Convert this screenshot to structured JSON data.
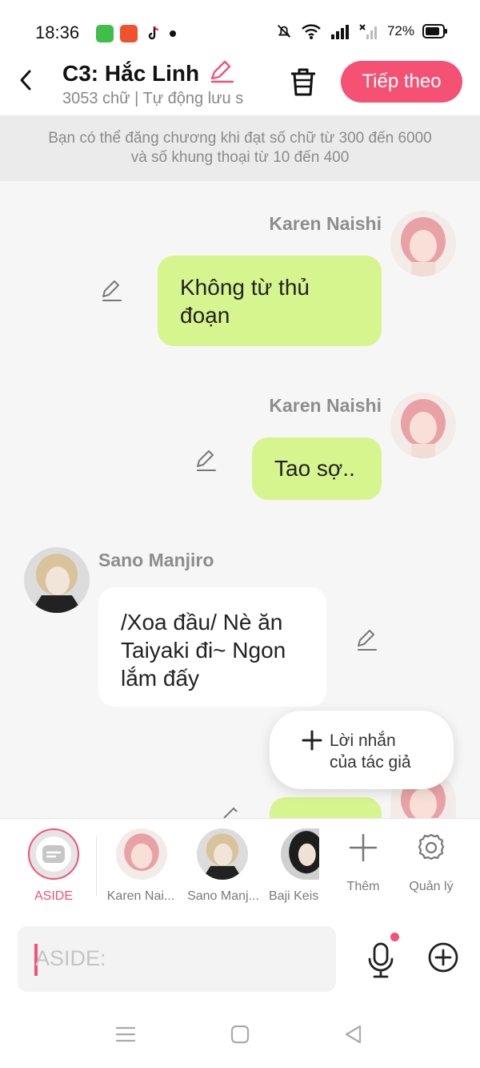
{
  "status": {
    "time": "18:36",
    "battery": "72%"
  },
  "header": {
    "title": "C3: Hắc Linh",
    "subtitle": "3053 chữ | Tự động lưu s",
    "next_label": "Tiếp theo"
  },
  "notice": "Bạn có thể đăng chương khi đạt số chữ từ 300 đến 6000 và số khung thoại từ 10 đến 400",
  "messages": [
    {
      "speaker": "Karen Naishi",
      "text": "Không từ thủ đoạn"
    },
    {
      "speaker": "Karen Naishi",
      "text": "Tao sợ.."
    },
    {
      "speaker": "Sano Manjiro",
      "text": "/Xoa đầu/ Nè ăn Taiyaki đi~ Ngon lắm đấy"
    }
  ],
  "popup": {
    "line1": "Lời nhắn",
    "line2": "của tác giả"
  },
  "characters": [
    {
      "label": "ASIDE"
    },
    {
      "label": "Karen Nai..."
    },
    {
      "label": "Sano Manj..."
    },
    {
      "label": "Baji Keis"
    },
    {
      "label": "Thêm"
    },
    {
      "label": "Quản lý"
    }
  ],
  "input": {
    "placeholder": "ASIDE:"
  },
  "colors": {
    "accent": "#f45174",
    "bubble_green": "#d7f58f"
  }
}
